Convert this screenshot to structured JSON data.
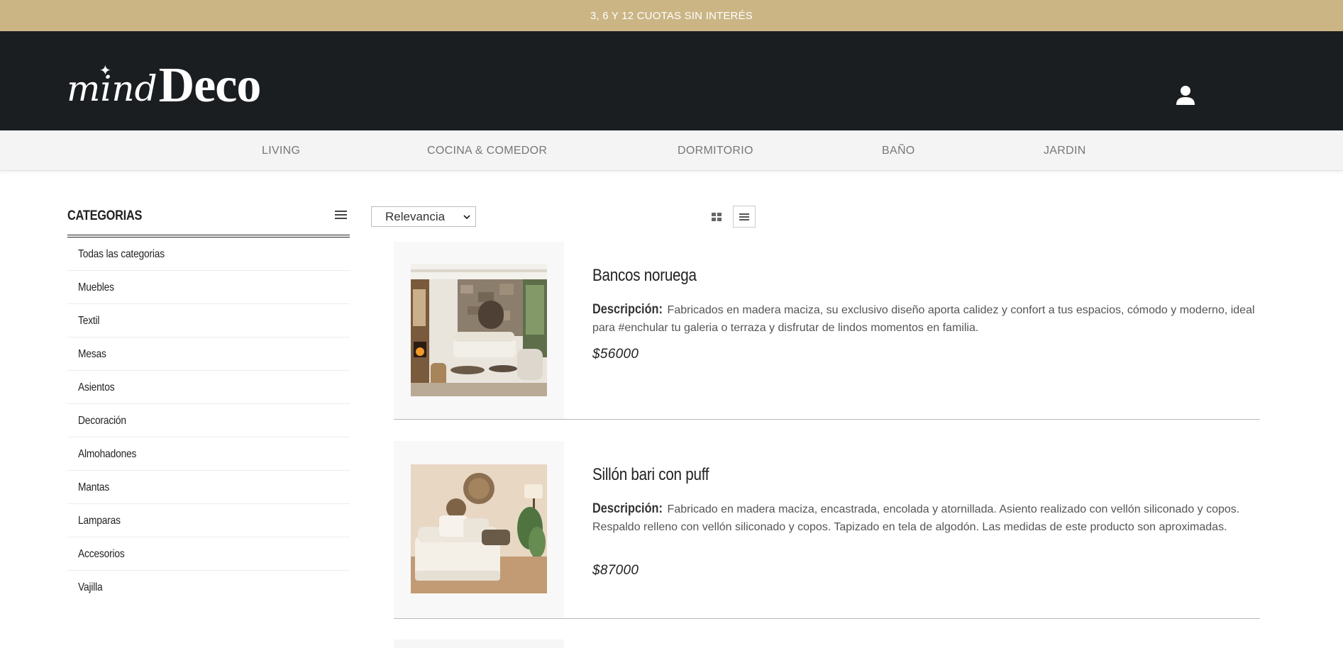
{
  "promo": {
    "text": "3, 6 Y 12 CUOTAS SIN INTERÉS"
  },
  "brand": {
    "script": "mind",
    "bold": "Deco"
  },
  "nav": {
    "items": [
      {
        "label": "LIVING"
      },
      {
        "label": "COCINA & COMEDOR"
      },
      {
        "label": "DORMITORIO"
      },
      {
        "label": "BAÑO"
      },
      {
        "label": "JARDIN"
      }
    ]
  },
  "sidebar": {
    "title": "CATEGORIAS",
    "items": [
      {
        "label": "Todas las categorias"
      },
      {
        "label": "Muebles"
      },
      {
        "label": "Textil"
      },
      {
        "label": "Mesas"
      },
      {
        "label": "Asientos"
      },
      {
        "label": "Decoración"
      },
      {
        "label": "Almohadones"
      },
      {
        "label": "Mantas"
      },
      {
        "label": "Lamparas"
      },
      {
        "label": "Accesorios"
      },
      {
        "label": "Vajilla"
      }
    ]
  },
  "toolbar": {
    "sort_value": "Relevancia"
  },
  "products": [
    {
      "name": "Bancos noruega",
      "desc_label": "Descripción:",
      "description": "Fabricados en madera maciza, su exclusivo diseño aporta calidez y confort a tus espacios, cómodo y moderno, ideal para #enchular tu galeria o terraza y disfrutar de lindos momentos en familia.",
      "price": "$56000"
    },
    {
      "name": "Sillón bari con puff",
      "desc_label": "Descripción:",
      "description": "Fabricado en madera maciza, encastrada, encolada y atornillada. Asiento realizado con vellón siliconado y copos. Respaldo relleno con vellón siliconado y copos. Tapizado en tela de algodón. Las medidas de este producto son aproximadas.",
      "price": "$87000"
    }
  ],
  "colors": {
    "promo": "#cbb585",
    "header": "#1b1e21",
    "nav": "#f4f4f4"
  },
  "icons": {
    "user": "user-icon",
    "menu": "hamburger-menu-icon",
    "grid": "grid-view-icon",
    "list": "list-view-icon"
  }
}
